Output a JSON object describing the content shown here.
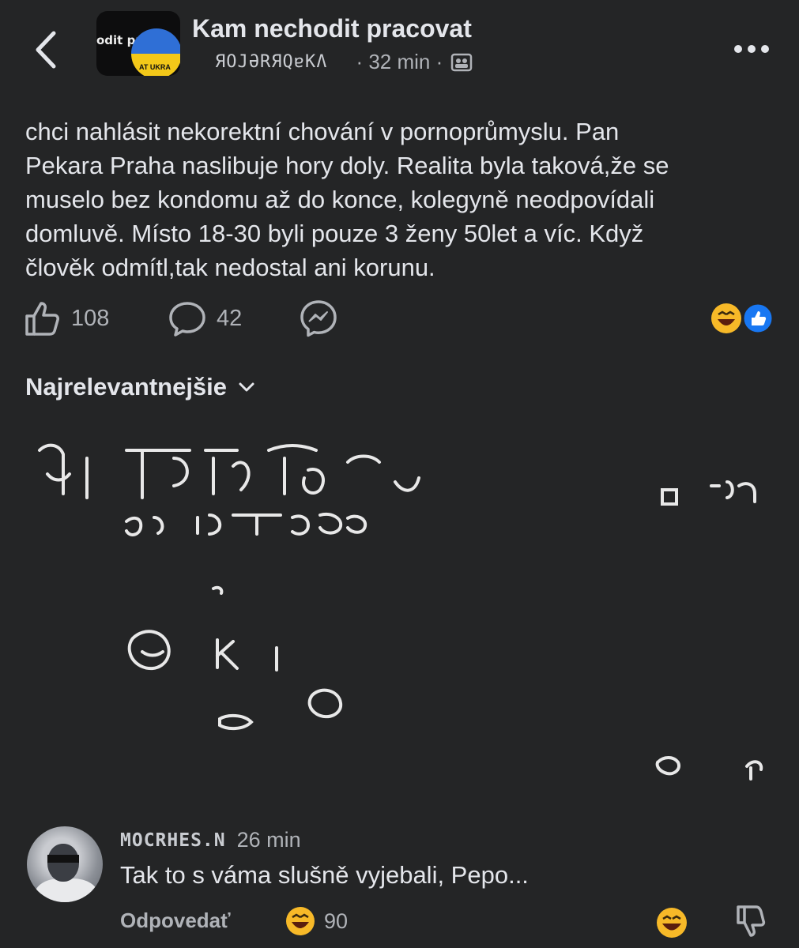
{
  "header": {
    "group_title": "Kam nechodit pracovat",
    "author_obscured": "ЯOJƏRЯQɐKɅ",
    "time": "· 32 min ·",
    "avatar_text": "odit pr",
    "avatar_subtext": "AT UKRA"
  },
  "post": {
    "lines": [
      "chci nahlásit nekorektní chování v pornoprůmyslu. Pan",
      "Pekara Praha naslibuje hory doly.  Realita byla taková,že se",
      "muselo bez kondomu až do konce, kolegyně neodpovídali",
      "domluvě. Místo 18-30 byli pouze 3 ženy 50let a víc. Když",
      "člověk odmítl,tak nedostal ani korunu."
    ]
  },
  "actions": {
    "likes": "108",
    "comments": "42"
  },
  "sort": {
    "label": "Najrelevantnejšie"
  },
  "comment": {
    "author": "MOCRHES.N",
    "time": "26 min",
    "text": "Tak to s váma slušně vyjebali,  Pepo...",
    "reply_label": "Odpovedať",
    "reaction_count": "90"
  },
  "icons": {
    "back": "chevron-left-icon",
    "more": "more-dots-icon",
    "group": "group-icon",
    "like": "thumbs-up-icon",
    "comment": "comment-bubble-icon",
    "share": "messenger-icon",
    "sort_chevron": "chevron-down-icon",
    "haha": "laughing-emoji-icon",
    "dislike": "thumbs-down-icon"
  },
  "colors": {
    "background": "#242526",
    "text": "#e4e6eb",
    "secondary": "#b0b3b8",
    "like_blue": "#1877f2",
    "emoji_yellow": "#f7b928"
  }
}
